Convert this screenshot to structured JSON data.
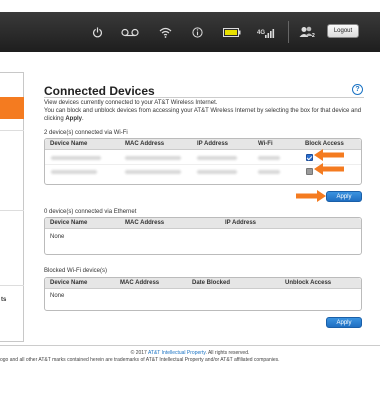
{
  "topbar": {
    "icons": [
      "power-icon",
      "voicemail-icon",
      "wifi-icon",
      "info-icon",
      "battery-icon",
      "signal-4g-icon",
      "users-icon"
    ],
    "signal_type": "4G",
    "users_count": "2",
    "logout_label": "Logout",
    "battery_color": "#e8e000",
    "accent_orange": "#f47b20"
  },
  "left": {
    "partial_label": "ts"
  },
  "main": {
    "title": "Connected Devices",
    "help_glyph": "?",
    "description_pre": "View devices currently connected to your AT&T Wireless Internet.",
    "description_line2": "You can block and unblock devices from accessing your AT&T Wireless Internet by selecting the box for that device and clicking ",
    "description_apply": "Apply",
    "description_end": "."
  },
  "wifi_section": {
    "label": "2 device(s) connected via Wi-Fi",
    "headers": [
      "Device Name",
      "MAC Address",
      "IP Address",
      "Wi-Fi",
      "Block Access"
    ],
    "rows": [
      {
        "block_access": true
      },
      {
        "block_access": false
      }
    ],
    "apply_label": "Apply"
  },
  "ethernet_section": {
    "label": "0 device(s) connected via Ethernet",
    "headers": [
      "Device Name",
      "MAC Address",
      "IP Address"
    ],
    "empty_text": "None"
  },
  "blocked_section": {
    "label": "Blocked Wi-Fi device(s)",
    "headers": [
      "Device Name",
      "MAC Address",
      "Date Blocked",
      "Unblock Access"
    ],
    "empty_text": "None",
    "apply_label": "Apply"
  },
  "footer": {
    "copyright_prefix": "© 2017 ",
    "copyright_link": "AT&T Intellectual Property",
    "copyright_suffix": ". All rights reserved.",
    "trademark": "ogo and all other AT&T marks contained herein are trademarks of AT&T Intellectual Property and/or AT&T affiliated companies."
  }
}
